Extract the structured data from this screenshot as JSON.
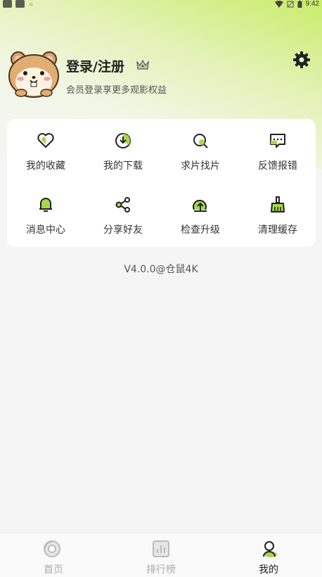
{
  "colors": {
    "accent": "#9bd43a",
    "text_primary": "#222222",
    "text_secondary": "#555555",
    "nav_inactive": "#aaaaaa"
  },
  "status_bar": {
    "time": "9:42"
  },
  "profile": {
    "avatar_icon": "hamster-avatar",
    "title": "登录/注册",
    "subtitle": "会员登录享更多观影权益",
    "crown_icon": "crown-icon",
    "settings_icon": "gear-icon"
  },
  "grid": {
    "items": [
      {
        "label": "我的收藏",
        "icon": "heart-icon"
      },
      {
        "label": "我的下载",
        "icon": "download-icon"
      },
      {
        "label": "求片找片",
        "icon": "search-icon"
      },
      {
        "label": "反馈报错",
        "icon": "feedback-icon"
      },
      {
        "label": "消息中心",
        "icon": "bell-icon"
      },
      {
        "label": "分享好友",
        "icon": "share-icon"
      },
      {
        "label": "检查升级",
        "icon": "upgrade-icon"
      },
      {
        "label": "清理缓存",
        "icon": "broom-icon"
      }
    ]
  },
  "version": "V4.0.0@仓鼠4K",
  "bottom_nav": {
    "items": [
      {
        "label": "首页",
        "icon": "home-icon",
        "active": false
      },
      {
        "label": "排行榜",
        "icon": "ranking-icon",
        "active": false
      },
      {
        "label": "我的",
        "icon": "profile-icon",
        "active": true
      }
    ]
  }
}
